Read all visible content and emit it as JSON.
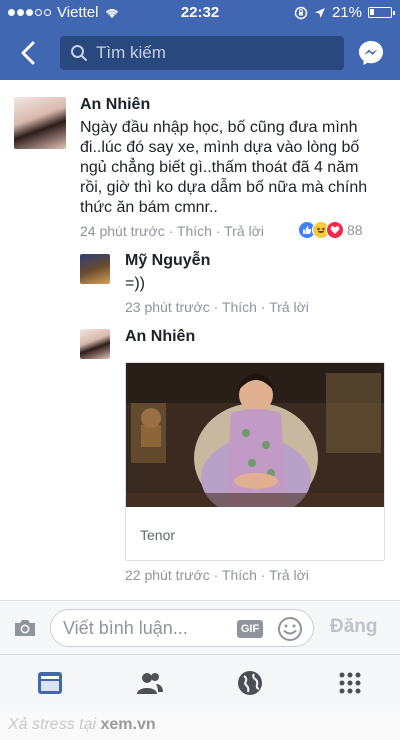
{
  "status_bar": {
    "carrier": "Viettel",
    "time": "22:32",
    "battery_percent": "21%",
    "battery_level": 0.21
  },
  "nav": {
    "search_placeholder": "Tìm kiếm"
  },
  "comments": [
    {
      "author": "An Nhiên",
      "text": "Ngày đầu nhập học, bố cũng đưa mình đi..lúc đó say xe, mình dựa vào lòng bố ngủ chẳng biết gì..thấm thoát đã 4 năm rồi, giờ thì ko dựa dẫm bố nữa mà chính thức ăn bám cmnr..",
      "time": "24 phút trước",
      "like": "Thích",
      "reply": "Trả lời",
      "reaction_count": "88",
      "reactions": [
        "like-icon",
        "haha-icon",
        "love-icon"
      ]
    },
    {
      "author": "Mỹ Nguyễn",
      "text": "=))",
      "time": "23 phút trước",
      "like": "Thích",
      "reply": "Trả lời"
    },
    {
      "author": "An Nhiên",
      "gif_source": "Tenor",
      "time": "22 phút trước",
      "like": "Thích",
      "reply": "Trả lời"
    }
  ],
  "composer": {
    "placeholder": "Viết bình luận...",
    "gif_label": "GIF",
    "post_label": "Đăng"
  },
  "tabs": [
    "news-feed-icon",
    "friends-icon",
    "globe-icon",
    "menu-grid-icon"
  ],
  "watermark": {
    "prefix": "Xả stress tại",
    "site": "xem.vn"
  },
  "colors": {
    "brand": "#4267b2",
    "meta": "#90949c"
  }
}
